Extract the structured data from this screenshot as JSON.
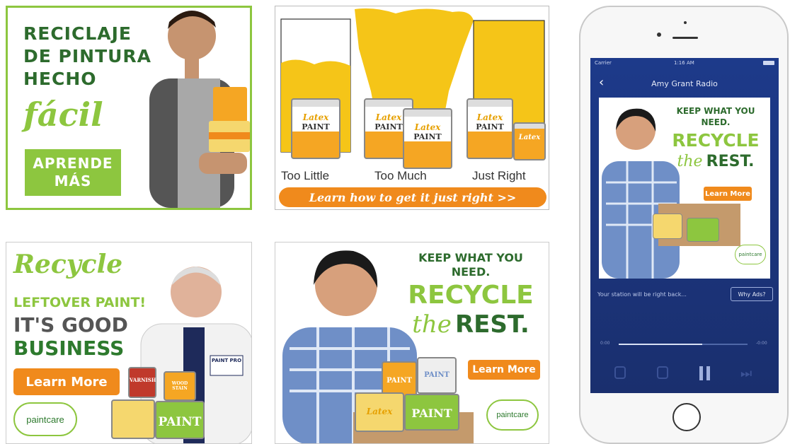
{
  "ad1": {
    "line1": "RECICLAJE",
    "line2": "DE PINTURA",
    "line3": "HECHO",
    "script": "fácil",
    "button_line1": "APRENDE",
    "button_line2": "MÁS"
  },
  "ad2": {
    "label_left": "Too Little",
    "label_mid": "Too Much",
    "label_right": "Just Right",
    "can_brand": "Latex",
    "can_label": "PAINT",
    "cta": "Learn how to get it just right >>"
  },
  "ad3": {
    "script": "Recycle",
    "line1": "LEFTOVER PAINT!",
    "line2": "IT'S GOOD",
    "line3": "BUSINESS",
    "button": "Learn More",
    "logo": "paintcare",
    "varnish": "VARNISH",
    "wood_stain": "WOOD STAIN",
    "paint": "PAINT",
    "jacket": "PAINT PRO"
  },
  "ad4": {
    "line1": "KEEP WHAT YOU",
    "line2": "NEED.",
    "line3": "RECYCLE",
    "script": "the",
    "line4": "REST.",
    "button": "Learn More",
    "logo": "paintcare",
    "can_a": "PAINT",
    "can_b": "PAINT",
    "can_c": "Latex",
    "can_d": "PAINT"
  },
  "phone": {
    "carrier": "Carrier",
    "time": "1:16 AM",
    "station": "Amy Grant Radio",
    "ad_line1": "KEEP WHAT YOU",
    "ad_line2": "NEED.",
    "ad_line3": "RECYCLE",
    "ad_script": "the",
    "ad_line4": "REST.",
    "ad_button": "Learn More",
    "ad_logo": "paintcare",
    "message": "Your station will be right back...",
    "why_ads": "Why Ads?",
    "time_left": "0:00",
    "time_right": "-0:00"
  },
  "colors": {
    "green_light": "#8dc63f",
    "green_dark": "#2d6b2d",
    "orange": "#f08a1c",
    "yellow": "#f5c518",
    "phone_blue": "#1d3a8a"
  }
}
